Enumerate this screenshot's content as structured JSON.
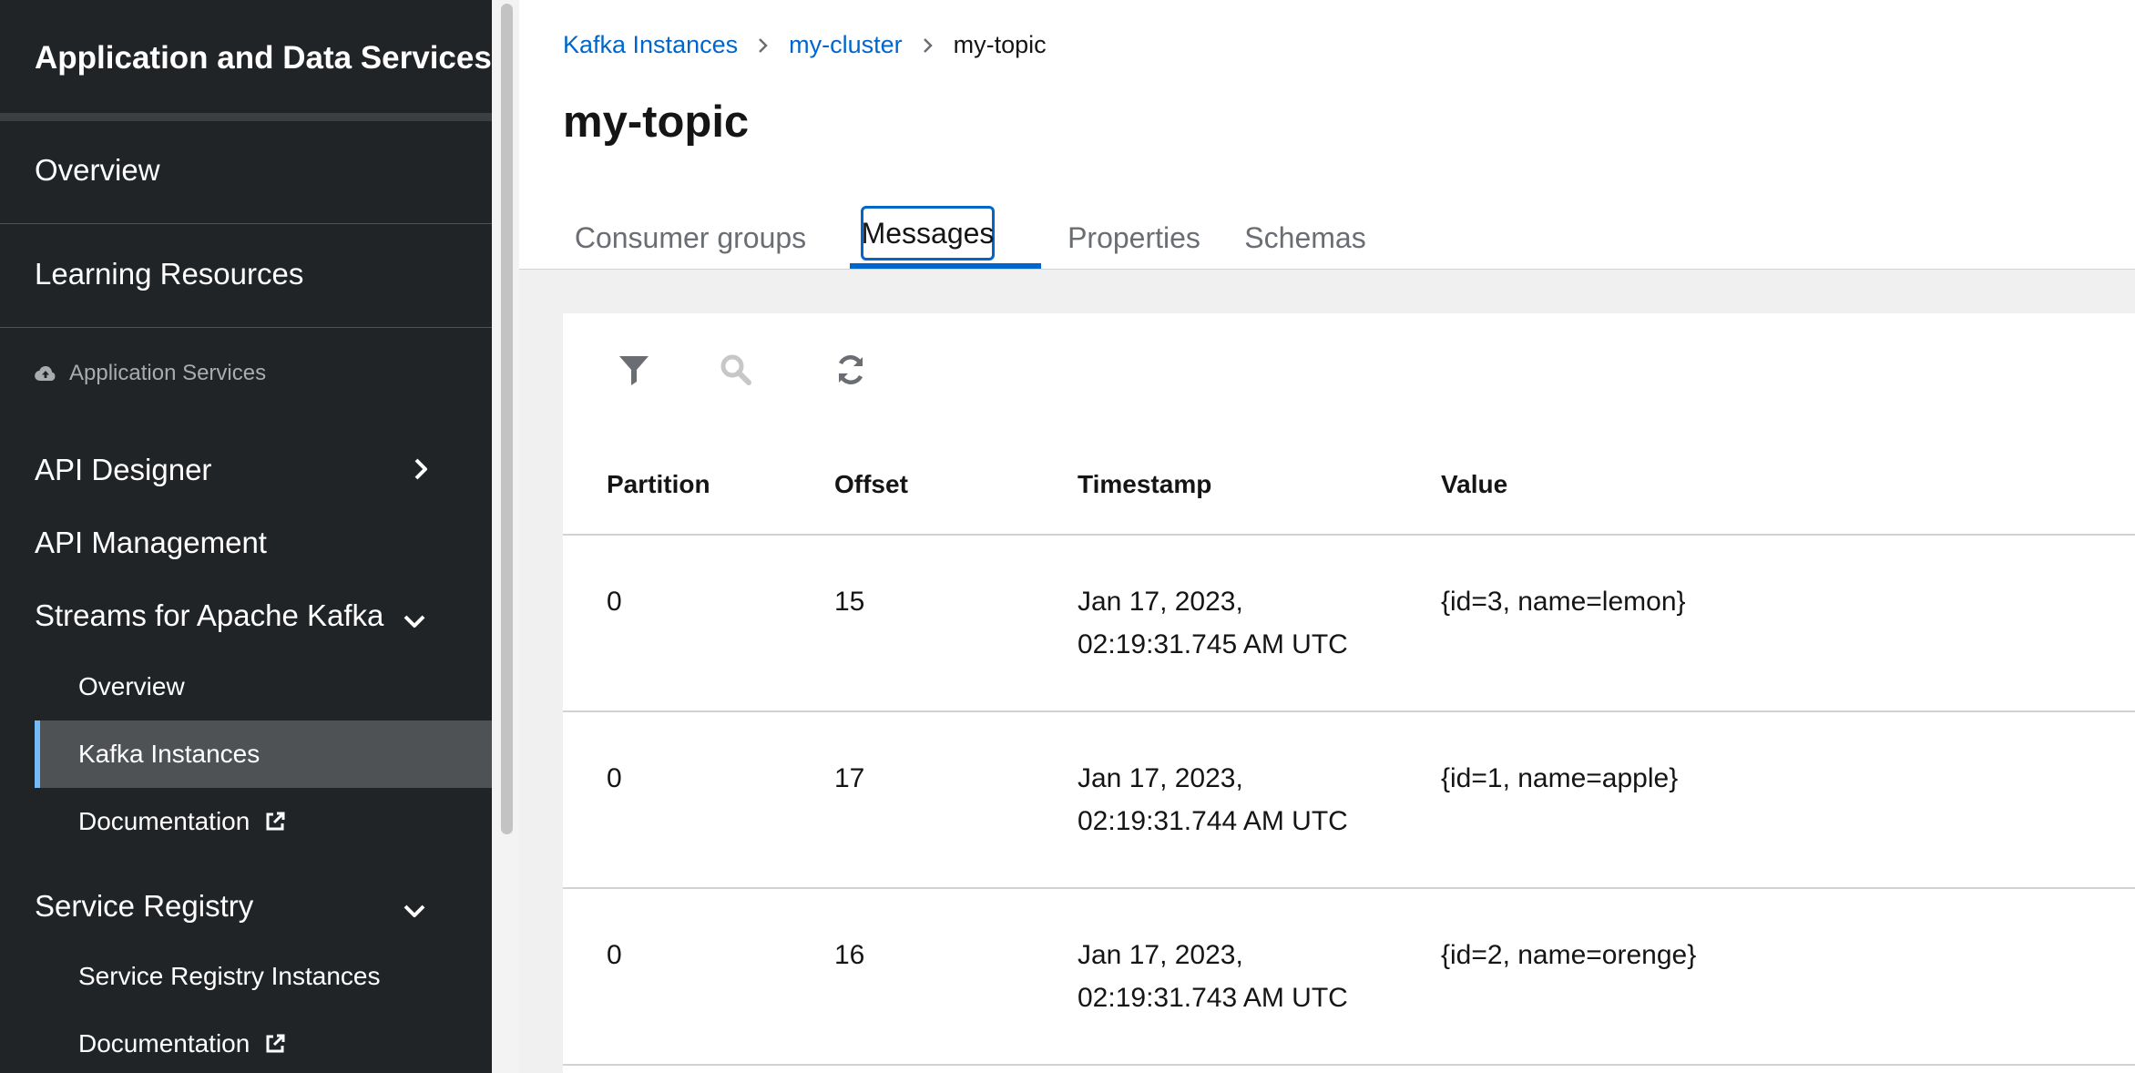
{
  "sidebar": {
    "app_title": "Application and Data Services",
    "overview": "Overview",
    "learning_resources": "Learning Resources",
    "section_label": "Application Services",
    "api_designer": "API Designer",
    "api_management": "API Management",
    "streams": {
      "label": "Streams for Apache Kafka",
      "items": [
        {
          "label": "Overview"
        },
        {
          "label": "Kafka Instances"
        },
        {
          "label": "Documentation"
        }
      ]
    },
    "service_registry": {
      "label": "Service Registry",
      "items": [
        {
          "label": "Service Registry Instances"
        },
        {
          "label": "Documentation"
        }
      ]
    }
  },
  "breadcrumb": [
    {
      "label": "Kafka Instances"
    },
    {
      "label": "my-cluster"
    },
    {
      "label": "my-topic"
    }
  ],
  "page_title": "my-topic",
  "tabs": [
    {
      "label": "Consumer groups"
    },
    {
      "label": "Messages"
    },
    {
      "label": "Properties"
    },
    {
      "label": "Schemas"
    }
  ],
  "active_tab": "Messages",
  "toolbar": {
    "icons": [
      "filter-icon",
      "search-icon",
      "refresh-icon"
    ]
  },
  "table": {
    "columns": [
      "Partition",
      "Offset",
      "Timestamp",
      "Value"
    ],
    "rows": [
      {
        "partition": "0",
        "offset": "15",
        "timestamp_date": "Jan 17, 2023,",
        "timestamp_time": "02:19:31.745 AM UTC",
        "value": "{id=3, name=lemon}"
      },
      {
        "partition": "0",
        "offset": "17",
        "timestamp_date": "Jan 17, 2023,",
        "timestamp_time": "02:19:31.744 AM UTC",
        "value": "{id=1, name=apple}"
      },
      {
        "partition": "0",
        "offset": "16",
        "timestamp_date": "Jan 17, 2023,",
        "timestamp_time": "02:19:31.743 AM UTC",
        "value": "{id=2, name=orenge}"
      }
    ]
  },
  "colors": {
    "sidebar_bg": "#212427",
    "active_nav_bg": "#4f5255",
    "active_nav_bar": "#73bcf7",
    "link": "#0066cc",
    "content_bg": "#f0f0f0"
  }
}
